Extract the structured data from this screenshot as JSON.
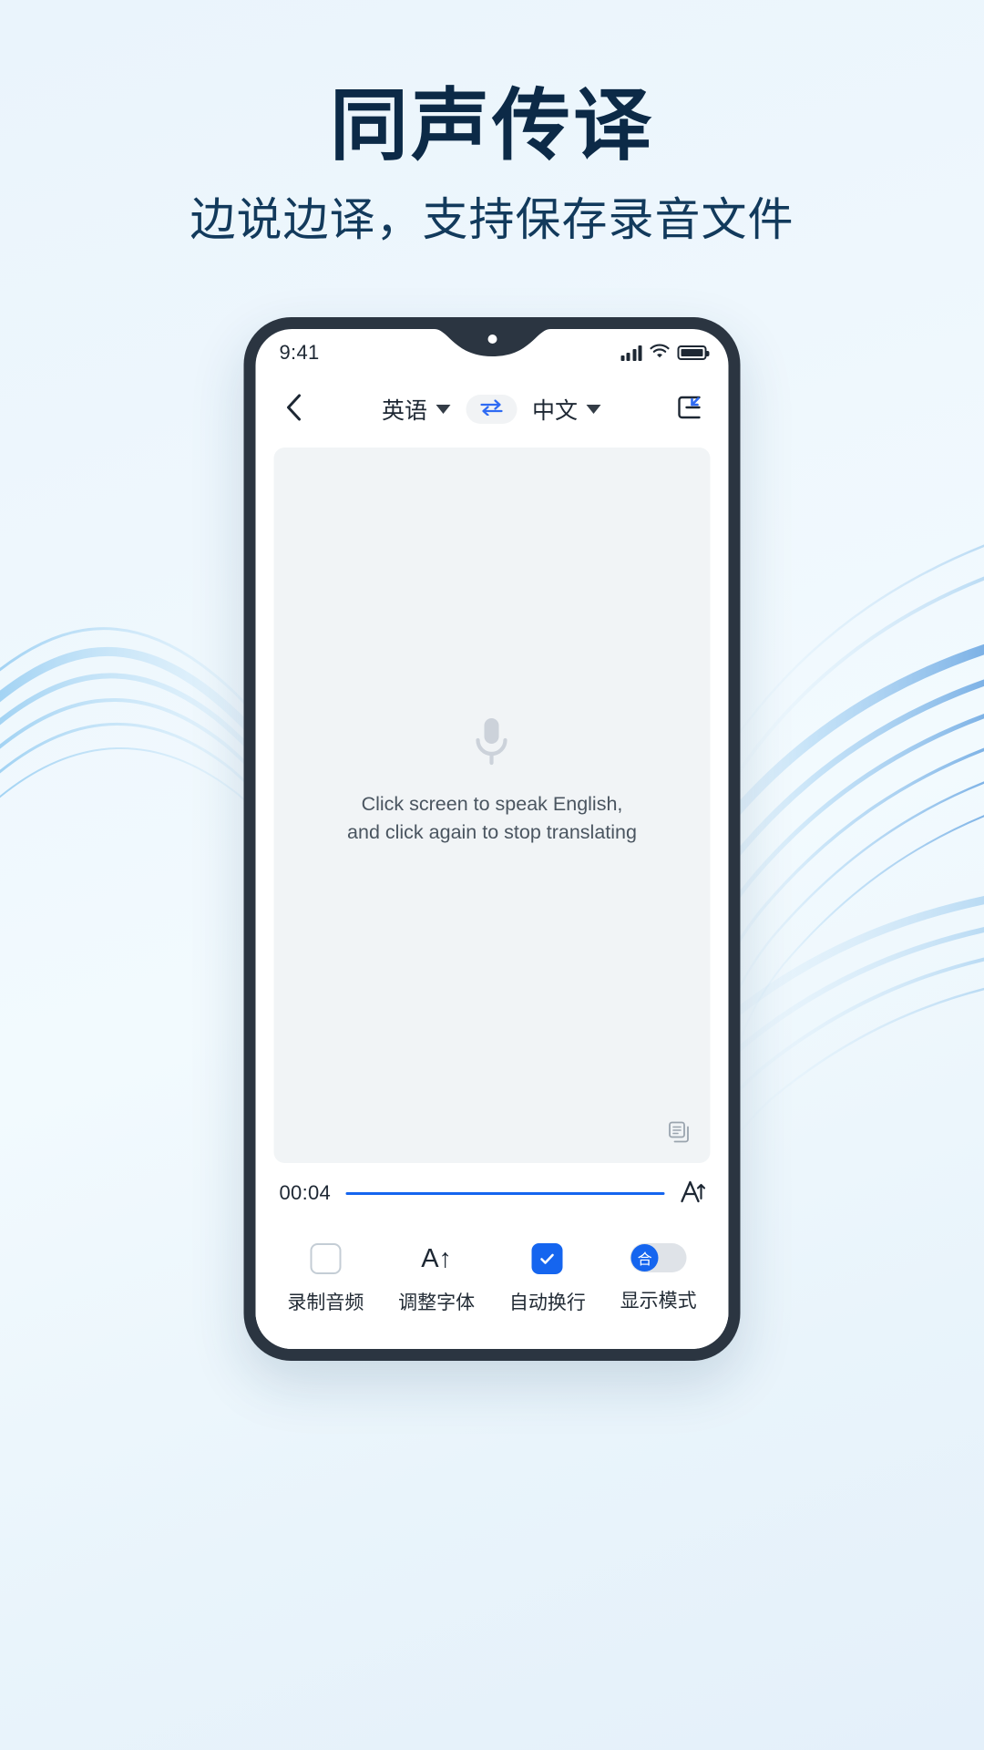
{
  "promo": {
    "headline": "同声传译",
    "subhead": "边说边译，支持保存录音文件"
  },
  "colors": {
    "accent": "#1565ef",
    "headline": "#0c2a47",
    "panel_bg": "#f1f4f6",
    "frame": "#2b3541"
  },
  "phone": {
    "status": {
      "time": "9:41",
      "signal_icon": "signal-bars-icon",
      "wifi_icon": "wifi-icon",
      "battery_icon": "battery-icon"
    },
    "navbar": {
      "back_icon": "chevron-left-icon",
      "source_language": "英语",
      "target_language": "中文",
      "swap_icon": "swap-arrows-icon",
      "fullscreen_icon": "collapse-screen-icon"
    },
    "panel": {
      "mic_icon": "microphone-icon",
      "hint_line1": "Click screen to speak English,",
      "hint_line2": "and click again to stop translating",
      "copy_icon": "copy-icon"
    },
    "progress": {
      "elapsed": "00:04",
      "percent": 100,
      "font_size_icon": "font-resize-icon"
    },
    "bottom_bar": [
      {
        "label": "录制音频",
        "icon": "checkbox-unchecked-icon",
        "state": "off"
      },
      {
        "label": "调整字体",
        "icon": "font-increase-icon",
        "state": "action"
      },
      {
        "label": "自动换行",
        "icon": "checkbox-checked-icon",
        "state": "on"
      },
      {
        "label": "显示模式",
        "icon": "mode-toggle-icon",
        "state": "on",
        "knob_label": "合"
      }
    ]
  }
}
